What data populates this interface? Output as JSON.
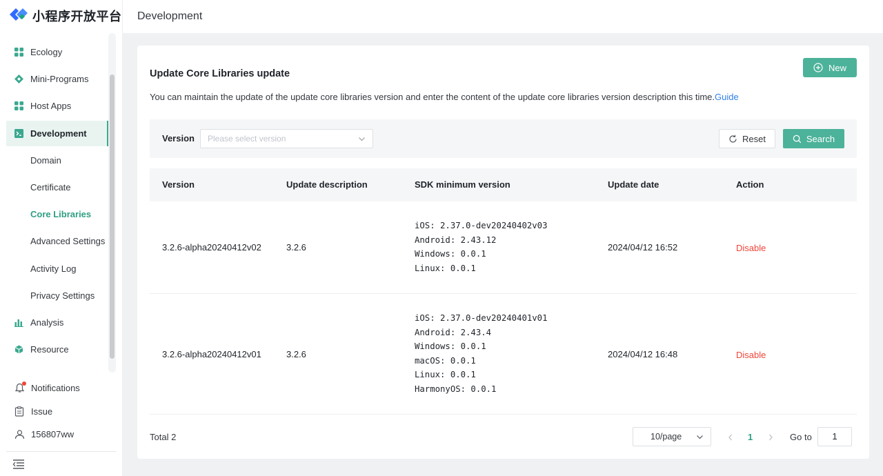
{
  "brand": {
    "name": "小程序开放平台",
    "accent": "#4cb29a",
    "logo_blue": "#2f6bff"
  },
  "sidebar": {
    "items": [
      {
        "label": "Ecology",
        "icon": "grid-icon"
      },
      {
        "label": "Mini-Programs",
        "icon": "diamond-icon"
      },
      {
        "label": "Host Apps",
        "icon": "grid-icon"
      },
      {
        "label": "Development",
        "icon": "terminal-icon",
        "active": true
      },
      {
        "label": "Domain",
        "sub": true
      },
      {
        "label": "Certificate",
        "sub": true
      },
      {
        "label": "Core Libraries",
        "sub": true,
        "selected": true
      },
      {
        "label": "Advanced Settings",
        "sub": true
      },
      {
        "label": "Activity Log",
        "sub": true
      },
      {
        "label": "Privacy Settings",
        "sub": true
      },
      {
        "label": "Analysis",
        "icon": "bar-chart-icon"
      },
      {
        "label": "Resource",
        "icon": "box-icon"
      }
    ],
    "bottom": {
      "notifications": "Notifications",
      "issue": "Issue",
      "user": "156807ww"
    }
  },
  "header": {
    "title": "Development"
  },
  "page": {
    "title": "Update Core Libraries update",
    "description": "You can maintain the update of the update core libraries version and enter the content of the update core libraries version description this time.",
    "guide_link": "Guide",
    "new_button": "New"
  },
  "filter": {
    "version_label": "Version",
    "version_placeholder": "Please select version",
    "reset_button": "Reset",
    "search_button": "Search"
  },
  "table": {
    "columns": [
      "Version",
      "Update description",
      "SDK minimum version",
      "Update date",
      "Action"
    ],
    "rows": [
      {
        "version": "3.2.6-alpha20240412v02",
        "description": "3.2.6",
        "sdk": "iOS: 2.37.0-dev20240402v03\nAndroid: 2.43.12\nWindows: 0.0.1\nLinux: 0.0.1",
        "date": "2024/04/12 16:52",
        "action": "Disable"
      },
      {
        "version": "3.2.6-alpha20240412v01",
        "description": "3.2.6",
        "sdk": "iOS: 2.37.0-dev20240401v01\nAndroid: 2.43.4\nWindows: 0.0.1\nmacOS: 0.0.1\nLinux: 0.0.1\nHarmonyOS: 0.0.1",
        "date": "2024/04/12 16:48",
        "action": "Disable"
      }
    ]
  },
  "pagination": {
    "total": "Total 2",
    "page_size": "10/page",
    "current_page": "1",
    "goto_label": "Go to",
    "goto_value": "1"
  }
}
